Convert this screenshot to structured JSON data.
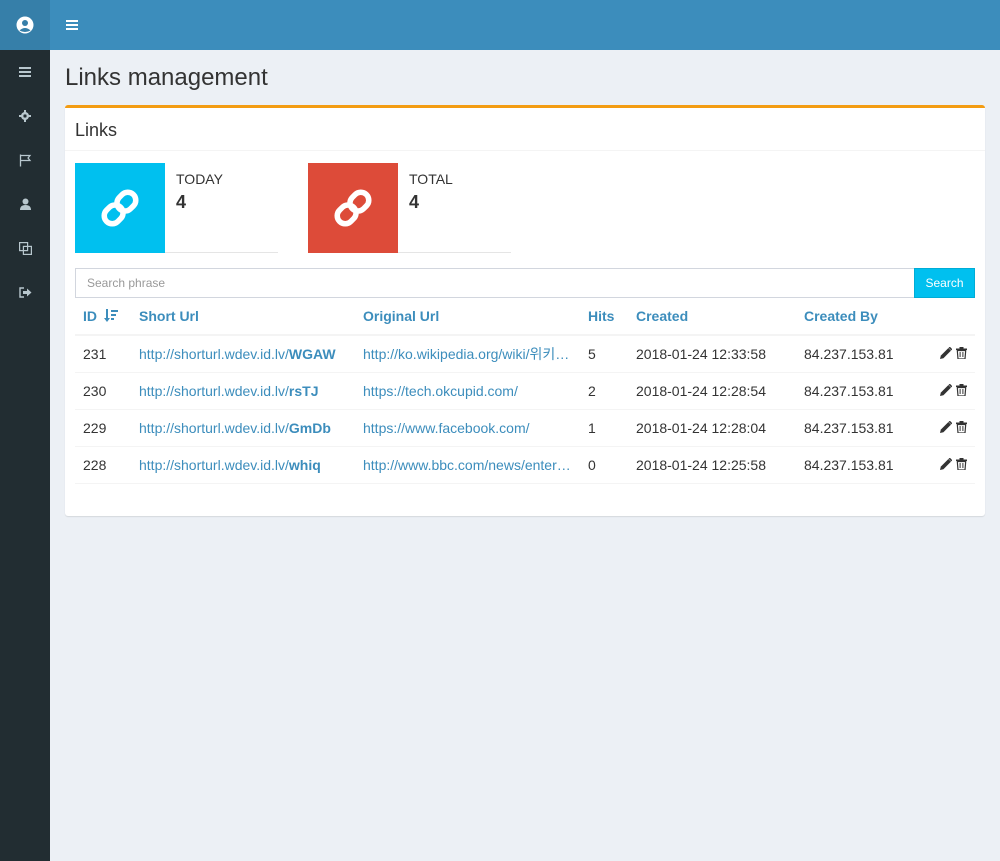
{
  "page": {
    "title": "Links management"
  },
  "box": {
    "title": "Links"
  },
  "stats": [
    {
      "label": "TODAY",
      "value": "4",
      "color": "#00c0ef",
      "icon": "link-icon"
    },
    {
      "label": "TOTAL",
      "value": "4",
      "color": "#dd4b39",
      "icon": "link-icon"
    }
  ],
  "search": {
    "placeholder": "Search phrase",
    "button": "Search"
  },
  "table": {
    "columns": [
      "ID",
      "Short Url",
      "Original Url",
      "Hits",
      "Created",
      "Created By"
    ],
    "rows": [
      {
        "id": "231",
        "short_base": "http://shorturl.wdev.id.lv/",
        "short_code": "WGAW",
        "original": "http://ko.wikipedia.org/wiki/위키백과",
        "hits": "5",
        "created": "2018-01-24 12:33:58",
        "by": "84.237.153.81"
      },
      {
        "id": "230",
        "short_base": "http://shorturl.wdev.id.lv/",
        "short_code": "rsTJ",
        "original": "https://tech.okcupid.com/",
        "hits": "2",
        "created": "2018-01-24 12:28:54",
        "by": "84.237.153.81"
      },
      {
        "id": "229",
        "short_base": "http://shorturl.wdev.id.lv/",
        "short_code": "GmDb",
        "original": "https://www.facebook.com/",
        "hits": "1",
        "created": "2018-01-24 12:28:04",
        "by": "84.237.153.81"
      },
      {
        "id": "228",
        "short_base": "http://shorturl.wdev.id.lv/",
        "short_code": "whiq",
        "original": "http://www.bbc.com/news/entertainment-arts",
        "hits": "0",
        "created": "2018-01-24 12:25:58",
        "by": "84.237.153.81"
      }
    ]
  },
  "colors": {
    "accent": "#3c8dbc",
    "sidebar": "#222d32",
    "warning": "#f39c12"
  }
}
